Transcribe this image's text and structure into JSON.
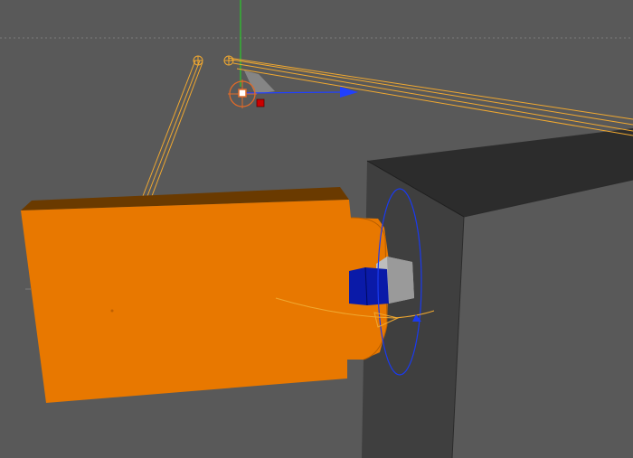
{
  "viewport": {
    "view": "3d-viewport",
    "background_color": "#595959",
    "horizon_line_color": "#7a7a7a",
    "axis_y_color": "#28c828"
  },
  "objects": {
    "box_color": "#3f3f3f",
    "box_top_color": "#2c2c2c",
    "panel_color": "#e87800",
    "panel_top_color": "#6a3a00",
    "hinge_block_color": "#0a1aa8",
    "hinge_pin_color": "#bdbdbd",
    "rig_line_color": "#f0a830"
  },
  "gizmo": {
    "ring_color": "#e06a28",
    "move_arrow_color": "#2040ff",
    "center_marker_color": "#ffffff",
    "handle_color": "#cc0000",
    "rotation_ring_color": "#1a3af0"
  }
}
